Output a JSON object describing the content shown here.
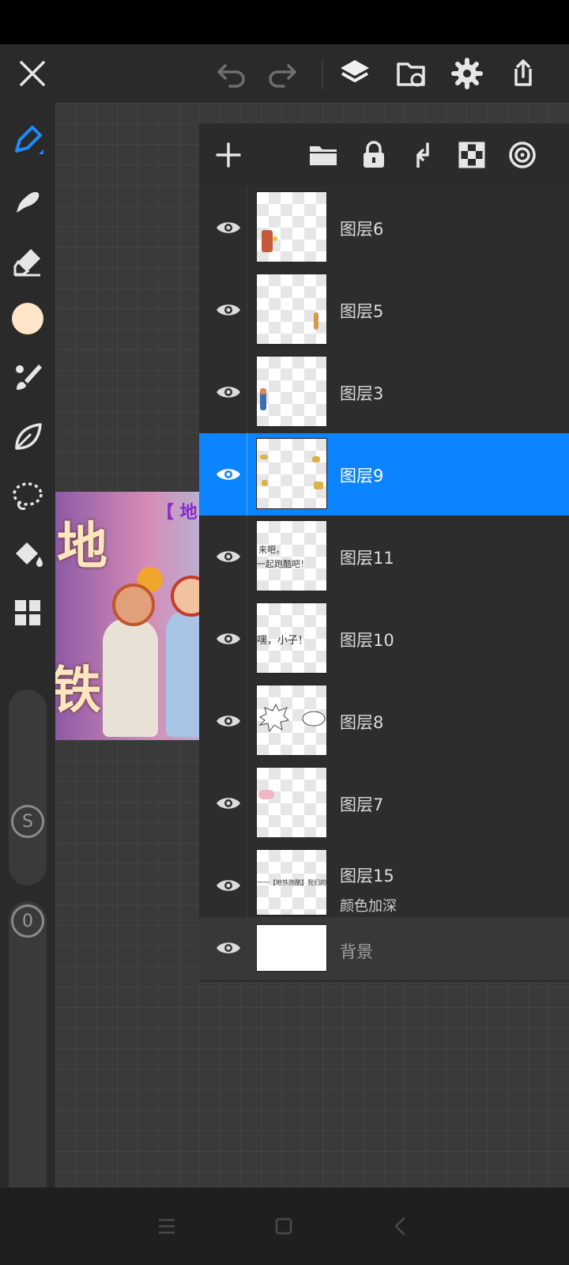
{
  "top_bar": {
    "icons": [
      "close-icon",
      "undo-icon",
      "redo-icon",
      "layers-icon",
      "import-folder-icon",
      "settings-icon",
      "share-icon"
    ]
  },
  "toolbar": {
    "tools": [
      "pen-icon",
      "smudge-icon",
      "eraser-icon",
      "color-swatch",
      "brush-icon",
      "leaf-icon",
      "lasso-icon",
      "fill-icon",
      "grid-icon"
    ],
    "color": "#ffe6c9",
    "size_label": "S",
    "opacity_label": "0"
  },
  "artwork": {
    "glyph_top": "地",
    "glyph_bottom": "铁",
    "banner_text": "【 地 "
  },
  "layers_panel": {
    "header_icons": [
      "add-layer-icon",
      "folder-icon",
      "lock-icon",
      "merge-down-icon",
      "transparency-icon",
      "reference-icon"
    ],
    "layers": [
      {
        "name": "图层6",
        "visible": true,
        "selected": false,
        "thumb": "figure-bottom-left"
      },
      {
        "name": "图层5",
        "visible": true,
        "selected": false,
        "thumb": "figure-right"
      },
      {
        "name": "图层3",
        "visible": true,
        "selected": false,
        "thumb": "figure-left"
      },
      {
        "name": "图层9",
        "visible": true,
        "selected": true,
        "thumb": "sparkles"
      },
      {
        "name": "图层11",
        "visible": true,
        "selected": false,
        "thumb": "text-11"
      },
      {
        "name": "图层10",
        "visible": true,
        "selected": false,
        "thumb": "text-10"
      },
      {
        "name": "图层8",
        "visible": true,
        "selected": false,
        "thumb": "bubbles"
      },
      {
        "name": "图层7",
        "visible": true,
        "selected": false,
        "thumb": "pink"
      },
      {
        "name": "图层15",
        "blend": "颜色加深",
        "visible": true,
        "selected": false,
        "thumb": "text-15"
      },
      {
        "name": "背景",
        "visible": true,
        "selected": false,
        "thumb": "white"
      }
    ],
    "thumb_text": {
      "text11_line1": "来吧，",
      "text11_line2": "一起跑酷吧！",
      "text10": "嘿，小子！",
      "text15": "一一【地铁跑酷】我们的"
    }
  },
  "colors": {
    "accent": "#0a84ff",
    "panel": "#2d2d2d",
    "background": "#2b2b2b"
  },
  "navbar": {
    "icons": [
      "menu-icon",
      "home-icon",
      "back-icon"
    ]
  }
}
